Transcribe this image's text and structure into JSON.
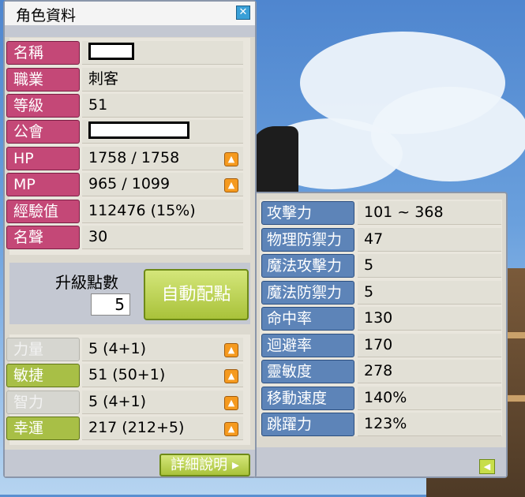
{
  "window": {
    "title": "角色資料",
    "close_icon": "close-icon"
  },
  "profile": [
    {
      "label": "名稱",
      "value": "",
      "redacted": true
    },
    {
      "label": "職業",
      "value": "刺客"
    },
    {
      "label": "等級",
      "value": "51"
    },
    {
      "label": "公會",
      "value": "",
      "redacted": true
    },
    {
      "label": "HP",
      "value": "1758 / 1758",
      "has_up": true
    },
    {
      "label": "MP",
      "value": "965 / 1099",
      "has_up": true
    },
    {
      "label": "經驗值",
      "value": "112476 (15%)"
    },
    {
      "label": "名聲",
      "value": "30"
    }
  ],
  "ability_points": {
    "label": "升級點數",
    "value": "5",
    "auto_button": "自動配點"
  },
  "stats": [
    {
      "label": "力量",
      "value": "5 (4+1)",
      "dim": true
    },
    {
      "label": "敏捷",
      "value": "51 (50+1)",
      "dim": false
    },
    {
      "label": "智力",
      "value": "5 (4+1)",
      "dim": true
    },
    {
      "label": "幸運",
      "value": "217 (212+5)",
      "dim": false
    }
  ],
  "detail_button": "詳細說明 ▸",
  "detail_stats": [
    {
      "label": "攻擊力",
      "value": "101 ~ 368"
    },
    {
      "label": "物理防禦力",
      "value": "47"
    },
    {
      "label": "魔法攻擊力",
      "value": "5"
    },
    {
      "label": "魔法防禦力",
      "value": "5"
    },
    {
      "label": "命中率",
      "value": "130"
    },
    {
      "label": "迴避率",
      "value": "170"
    },
    {
      "label": "靈敏度",
      "value": "278"
    },
    {
      "label": "移動速度",
      "value": "140%"
    },
    {
      "label": "跳躍力",
      "value": "123%"
    }
  ],
  "colors": {
    "profile_label": "#c44877",
    "stat_label": "#a8bf46",
    "detail_label": "#5d84b8",
    "up_button": "#f59a1f"
  }
}
